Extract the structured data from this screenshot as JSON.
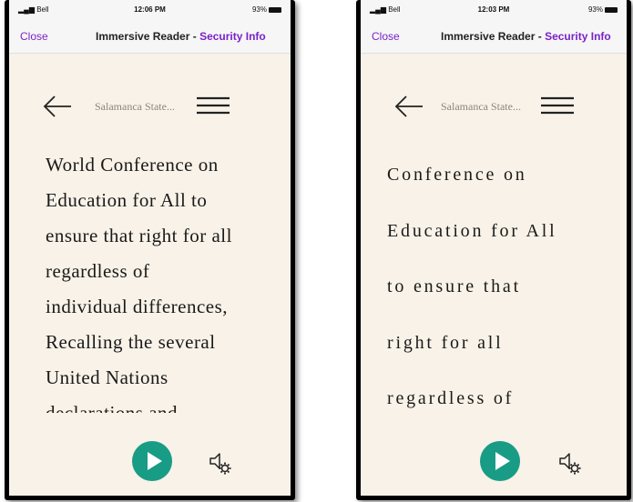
{
  "screens": [
    {
      "status": {
        "carrier": "Bell",
        "time": "12:06 PM",
        "battery": "93%"
      },
      "nav": {
        "close": "Close",
        "title": "Immersive Reader - ",
        "link": "Security Info"
      },
      "reader": {
        "doc_title": "Salamanca State...",
        "lines": [
          "World Conference on",
          "Education for All to",
          "ensure that right for all",
          "regardless of",
          "individual differences,",
          "Recalling the several",
          "United Nations",
          "declarations and"
        ]
      }
    },
    {
      "status": {
        "carrier": "Bell",
        "time": "12:03 PM",
        "battery": "93%"
      },
      "nav": {
        "close": "Close",
        "title": "Immersive Reader - ",
        "link": "Security Info"
      },
      "reader": {
        "doc_title": "Salamanca State...",
        "lines": [
          "Conference on",
          "Education for All",
          "to ensure that",
          "right for all",
          "regardless of"
        ]
      }
    }
  ],
  "icons": {
    "back": "arrow-left-icon",
    "menu": "hamburger-menu-icon",
    "play": "play-icon",
    "voice_settings": "voice-settings-icon"
  },
  "colors": {
    "page_background": "#f8f2e8",
    "accent_purple": "#7a22c8",
    "play_button": "#199c86"
  }
}
